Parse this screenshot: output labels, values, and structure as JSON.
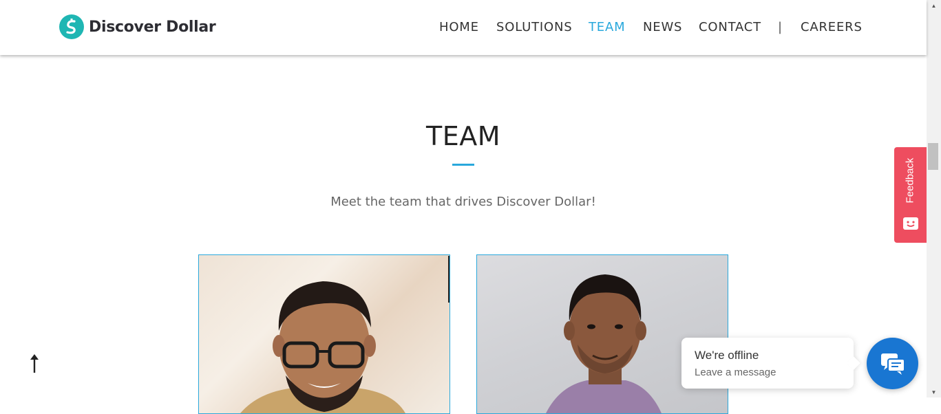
{
  "header": {
    "logo_text": "Discover Dollar",
    "nav": [
      {
        "label": "HOME"
      },
      {
        "label": "SOLUTIONS"
      },
      {
        "label": "TEAM",
        "active": true
      },
      {
        "label": "NEWS"
      },
      {
        "label": "CONTACT"
      },
      {
        "label": "CAREERS"
      }
    ],
    "separator": "|"
  },
  "team": {
    "title": "TEAM",
    "subtitle": "Meet the team that drives Discover Dollar!"
  },
  "feedback": {
    "label": "Feedback"
  },
  "chat": {
    "title": "We're offline",
    "subtitle": "Leave a message"
  },
  "colors": {
    "accent": "#29a8dc",
    "logo": "#1fb6b3",
    "feedback": "#ee4d5f",
    "chat": "#1976d2"
  },
  "icons": {
    "back_to_top": "arrow-up-icon",
    "chat": "chat-bubbles-icon",
    "feedback": "smiley-face-icon"
  }
}
